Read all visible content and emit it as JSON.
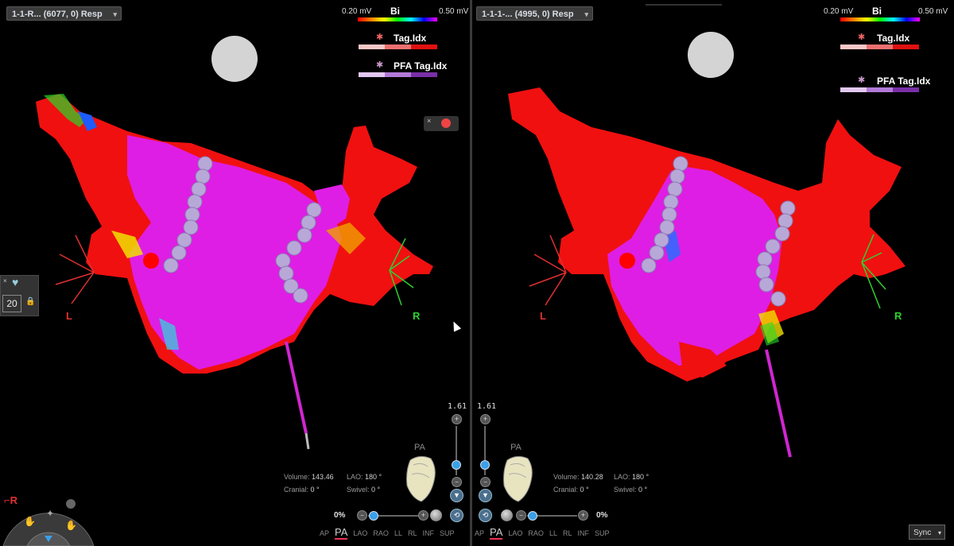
{
  "left": {
    "map_name": "1-1-R... (6077, 0) Resp",
    "legend_min": "0.20 mV",
    "legend_title": "Bi",
    "legend_max": "0.50 mV",
    "tag_label": "Tag.Idx",
    "pfa_label": "PFA Tag.Idx",
    "side_left": "L",
    "side_right": "R",
    "zoom": "1.61",
    "view_label": "PA",
    "volume_label": "Volume:",
    "volume_value": "143.46",
    "lao_label": "LAO:",
    "lao_value": "180 °",
    "cranial_label": "Cranial:",
    "cranial_value": "0 °",
    "swivel_label": "Swivel:",
    "swivel_value": "0 °",
    "transparency": "0%",
    "views": [
      "AP",
      "PA",
      "LAO",
      "RAO",
      "LL",
      "RL",
      "INF",
      "SUP"
    ],
    "active_view": "PA"
  },
  "right": {
    "map_name": "1-1-1-... (4995, 0) Resp",
    "legend_min": "0.20 mV",
    "legend_title": "Bi",
    "legend_max": "0.50 mV",
    "tag_label": "Tag.Idx",
    "pfa_label": "PFA Tag.Idx",
    "side_left": "L",
    "side_right": "R",
    "zoom": "1.61",
    "view_label": "PA",
    "volume_label": "Volume:",
    "volume_value": "140.28",
    "lao_label": "LAO:",
    "lao_value": "180 °",
    "cranial_label": "Cranial:",
    "cranial_value": "0 °",
    "swivel_label": "Swivel:",
    "swivel_value": "0 °",
    "transparency": "0%",
    "views": [
      "AP",
      "PA",
      "LAO",
      "RAO",
      "LL",
      "RL",
      "INF",
      "SUP"
    ],
    "active_view": "PA"
  },
  "side_panel": {
    "count": "20"
  },
  "sync": {
    "label": "Sync"
  },
  "icons": {
    "chevron": "▾",
    "close": "×",
    "plus": "+",
    "minus": "−",
    "lock": "🔒",
    "heart": "♥",
    "down": "▼"
  },
  "colors": {
    "scar": "#ff1414",
    "healthy": "#e01ee6",
    "catheter": "#d026d0",
    "lesion": "#b8a8d8",
    "axis_left": "#e03030",
    "axis_right": "#30d030"
  }
}
